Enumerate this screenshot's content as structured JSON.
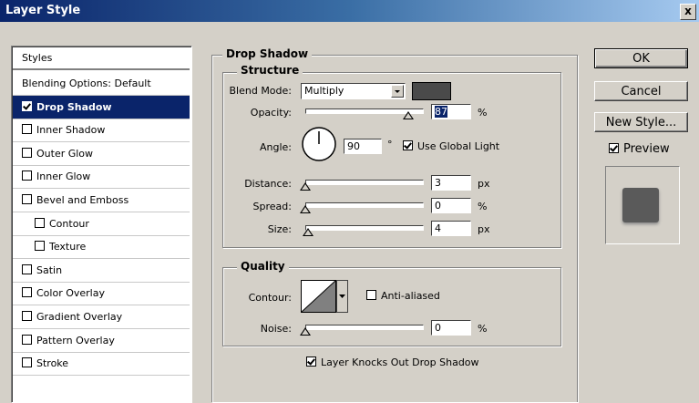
{
  "window": {
    "title": "Layer Style",
    "close": "x"
  },
  "styles_panel": {
    "header": "Styles",
    "items": [
      {
        "label": "Blending Options: Default",
        "checkbox": false,
        "checked": false,
        "selected": false,
        "indent": false
      },
      {
        "label": "Drop Shadow",
        "checkbox": true,
        "checked": true,
        "selected": true,
        "indent": false
      },
      {
        "label": "Inner Shadow",
        "checkbox": true,
        "checked": false,
        "selected": false,
        "indent": false
      },
      {
        "label": "Outer Glow",
        "checkbox": true,
        "checked": false,
        "selected": false,
        "indent": false
      },
      {
        "label": "Inner Glow",
        "checkbox": true,
        "checked": false,
        "selected": false,
        "indent": false
      },
      {
        "label": "Bevel and Emboss",
        "checkbox": true,
        "checked": false,
        "selected": false,
        "indent": false
      },
      {
        "label": "Contour",
        "checkbox": true,
        "checked": false,
        "selected": false,
        "indent": true
      },
      {
        "label": "Texture",
        "checkbox": true,
        "checked": false,
        "selected": false,
        "indent": true
      },
      {
        "label": "Satin",
        "checkbox": true,
        "checked": false,
        "selected": false,
        "indent": false
      },
      {
        "label": "Color Overlay",
        "checkbox": true,
        "checked": false,
        "selected": false,
        "indent": false
      },
      {
        "label": "Gradient Overlay",
        "checkbox": true,
        "checked": false,
        "selected": false,
        "indent": false
      },
      {
        "label": "Pattern Overlay",
        "checkbox": true,
        "checked": false,
        "selected": false,
        "indent": false
      },
      {
        "label": "Stroke",
        "checkbox": true,
        "checked": false,
        "selected": false,
        "indent": false
      }
    ]
  },
  "drop_shadow": {
    "title": "Drop Shadow",
    "structure": {
      "title": "Structure",
      "blend_mode_label": "Blend Mode:",
      "blend_mode_value": "Multiply",
      "shadow_color": "#4a4a4a",
      "opacity_label": "Opacity:",
      "opacity_value": "87",
      "opacity_unit": "%",
      "opacity_fraction": 0.87,
      "angle_label": "Angle:",
      "angle_value": "90",
      "angle_unit": "°",
      "use_global_light_label": "Use Global Light",
      "use_global_light": true,
      "distance_label": "Distance:",
      "distance_value": "3",
      "distance_unit": "px",
      "spread_label": "Spread:",
      "spread_value": "0",
      "spread_unit": "%",
      "size_label": "Size:",
      "size_value": "4",
      "size_unit": "px"
    },
    "quality": {
      "title": "Quality",
      "contour_label": "Contour:",
      "anti_aliased_label": "Anti-aliased",
      "anti_aliased": false,
      "noise_label": "Noise:",
      "noise_value": "0",
      "noise_unit": "%"
    },
    "knocks_out_label": "Layer Knocks Out Drop Shadow",
    "knocks_out": true
  },
  "buttons": {
    "ok": "OK",
    "cancel": "Cancel",
    "new_style": "New Style..."
  },
  "preview": {
    "label": "Preview",
    "checked": true,
    "swatch_color": "#5a5a5a"
  }
}
